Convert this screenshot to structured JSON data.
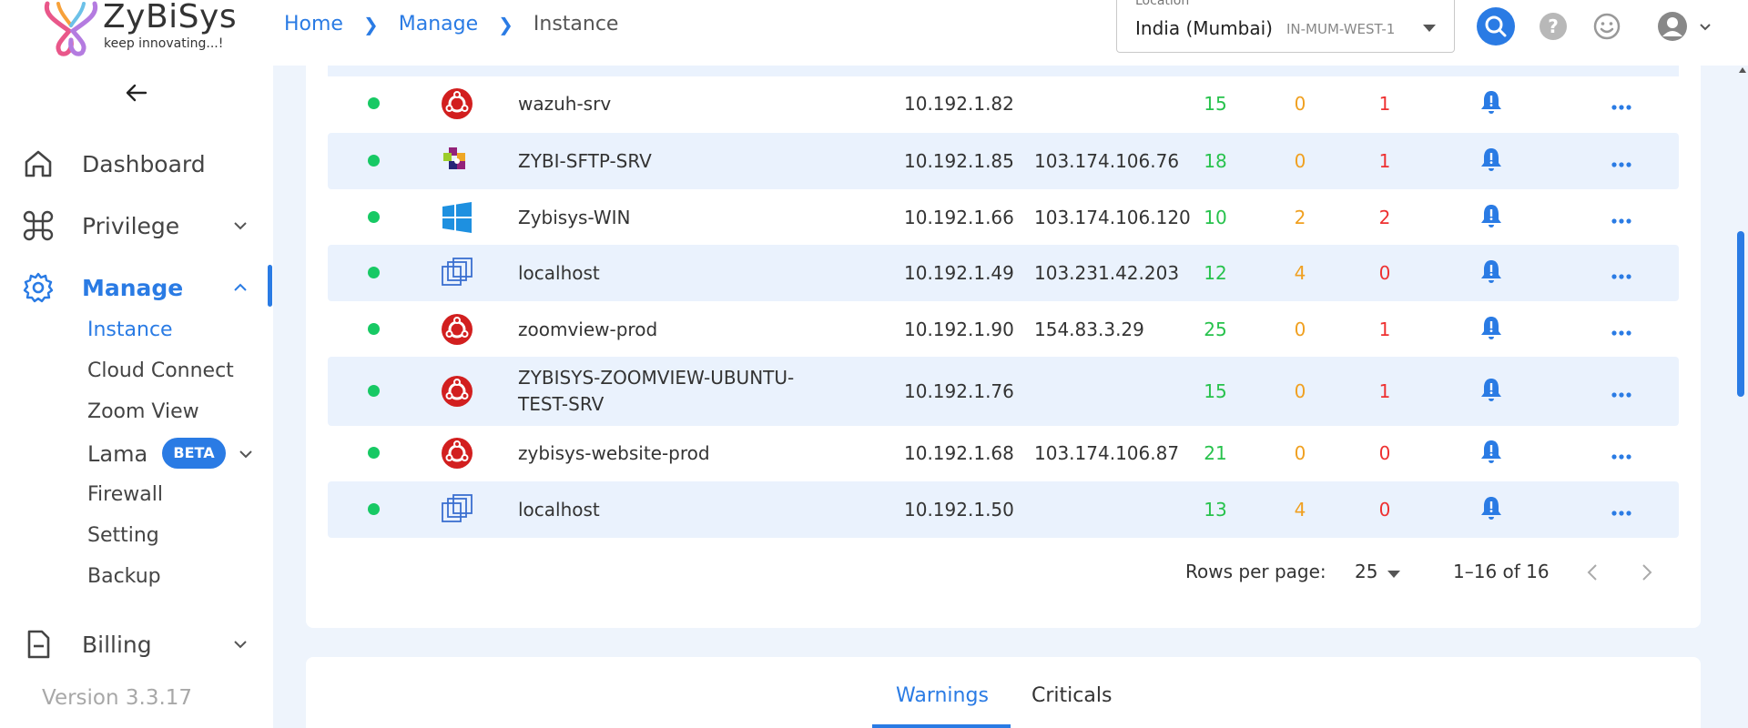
{
  "app": {
    "brand": "ZyBiSys",
    "tagline": "keep innovating...!"
  },
  "breadcrumb": [
    "Home",
    "Manage",
    "Instance"
  ],
  "location": {
    "label": "Location",
    "value": "India (Mumbai)",
    "code": "IN-MUM-WEST-1"
  },
  "header_icons": [
    "search-icon",
    "help-icon",
    "smile-icon",
    "avatar-icon",
    "chevron-down-icon"
  ],
  "sidebar": {
    "items": [
      {
        "label": "Dashboard",
        "icon": "home-icon"
      },
      {
        "label": "Privilege",
        "icon": "command-icon"
      },
      {
        "label": "Manage",
        "icon": "gear-icon"
      },
      {
        "label": "Billing",
        "icon": "document-icon"
      }
    ],
    "sub_items": [
      "Instance",
      "Cloud Connect",
      "Zoom View",
      "Lama",
      "Firewall",
      "Setting",
      "Backup"
    ],
    "beta_badge": "BETA",
    "version": "Version 3.3.17"
  },
  "instances": [
    {
      "name": "wazuh-srv",
      "os": "ubuntu",
      "private_ip": "10.192.1.82",
      "public_ip": "",
      "green": "15",
      "orange": "0",
      "red": "1"
    },
    {
      "name": "ZYBI-SFTP-SRV",
      "os": "centos",
      "private_ip": "10.192.1.85",
      "public_ip": "103.174.106.76",
      "green": "18",
      "orange": "0",
      "red": "1"
    },
    {
      "name": "Zybisys-WIN",
      "os": "windows",
      "private_ip": "10.192.1.66",
      "public_ip": "103.174.106.120",
      "green": "10",
      "orange": "2",
      "red": "2"
    },
    {
      "name": "localhost",
      "os": "vm",
      "private_ip": "10.192.1.49",
      "public_ip": "103.231.42.203",
      "green": "12",
      "orange": "4",
      "red": "0"
    },
    {
      "name": "zoomview-prod",
      "os": "ubuntu",
      "private_ip": "10.192.1.90",
      "public_ip": "154.83.3.29",
      "green": "25",
      "orange": "0",
      "red": "1"
    },
    {
      "name": "ZYBISYS-ZOOMVIEW-UBUNTU-TEST-SRV",
      "os": "ubuntu",
      "private_ip": "10.192.1.76",
      "public_ip": "",
      "green": "15",
      "orange": "0",
      "red": "1"
    },
    {
      "name": "zybisys-website-prod",
      "os": "ubuntu",
      "private_ip": "10.192.1.68",
      "public_ip": "103.174.106.87",
      "green": "21",
      "orange": "0",
      "red": "0"
    },
    {
      "name": "localhost",
      "os": "vm",
      "private_ip": "10.192.1.50",
      "public_ip": "",
      "green": "13",
      "orange": "4",
      "red": "0"
    }
  ],
  "pagination": {
    "rows_label": "Rows per page:",
    "rows_value": "25",
    "range": "1–16 of 16"
  },
  "tabs": [
    "Warnings",
    "Criticals"
  ],
  "colors": {
    "accent": "#2a7be4",
    "ok": "#17c964",
    "green": "#27c24c",
    "orange": "#f0a020",
    "red": "#ee3030"
  }
}
